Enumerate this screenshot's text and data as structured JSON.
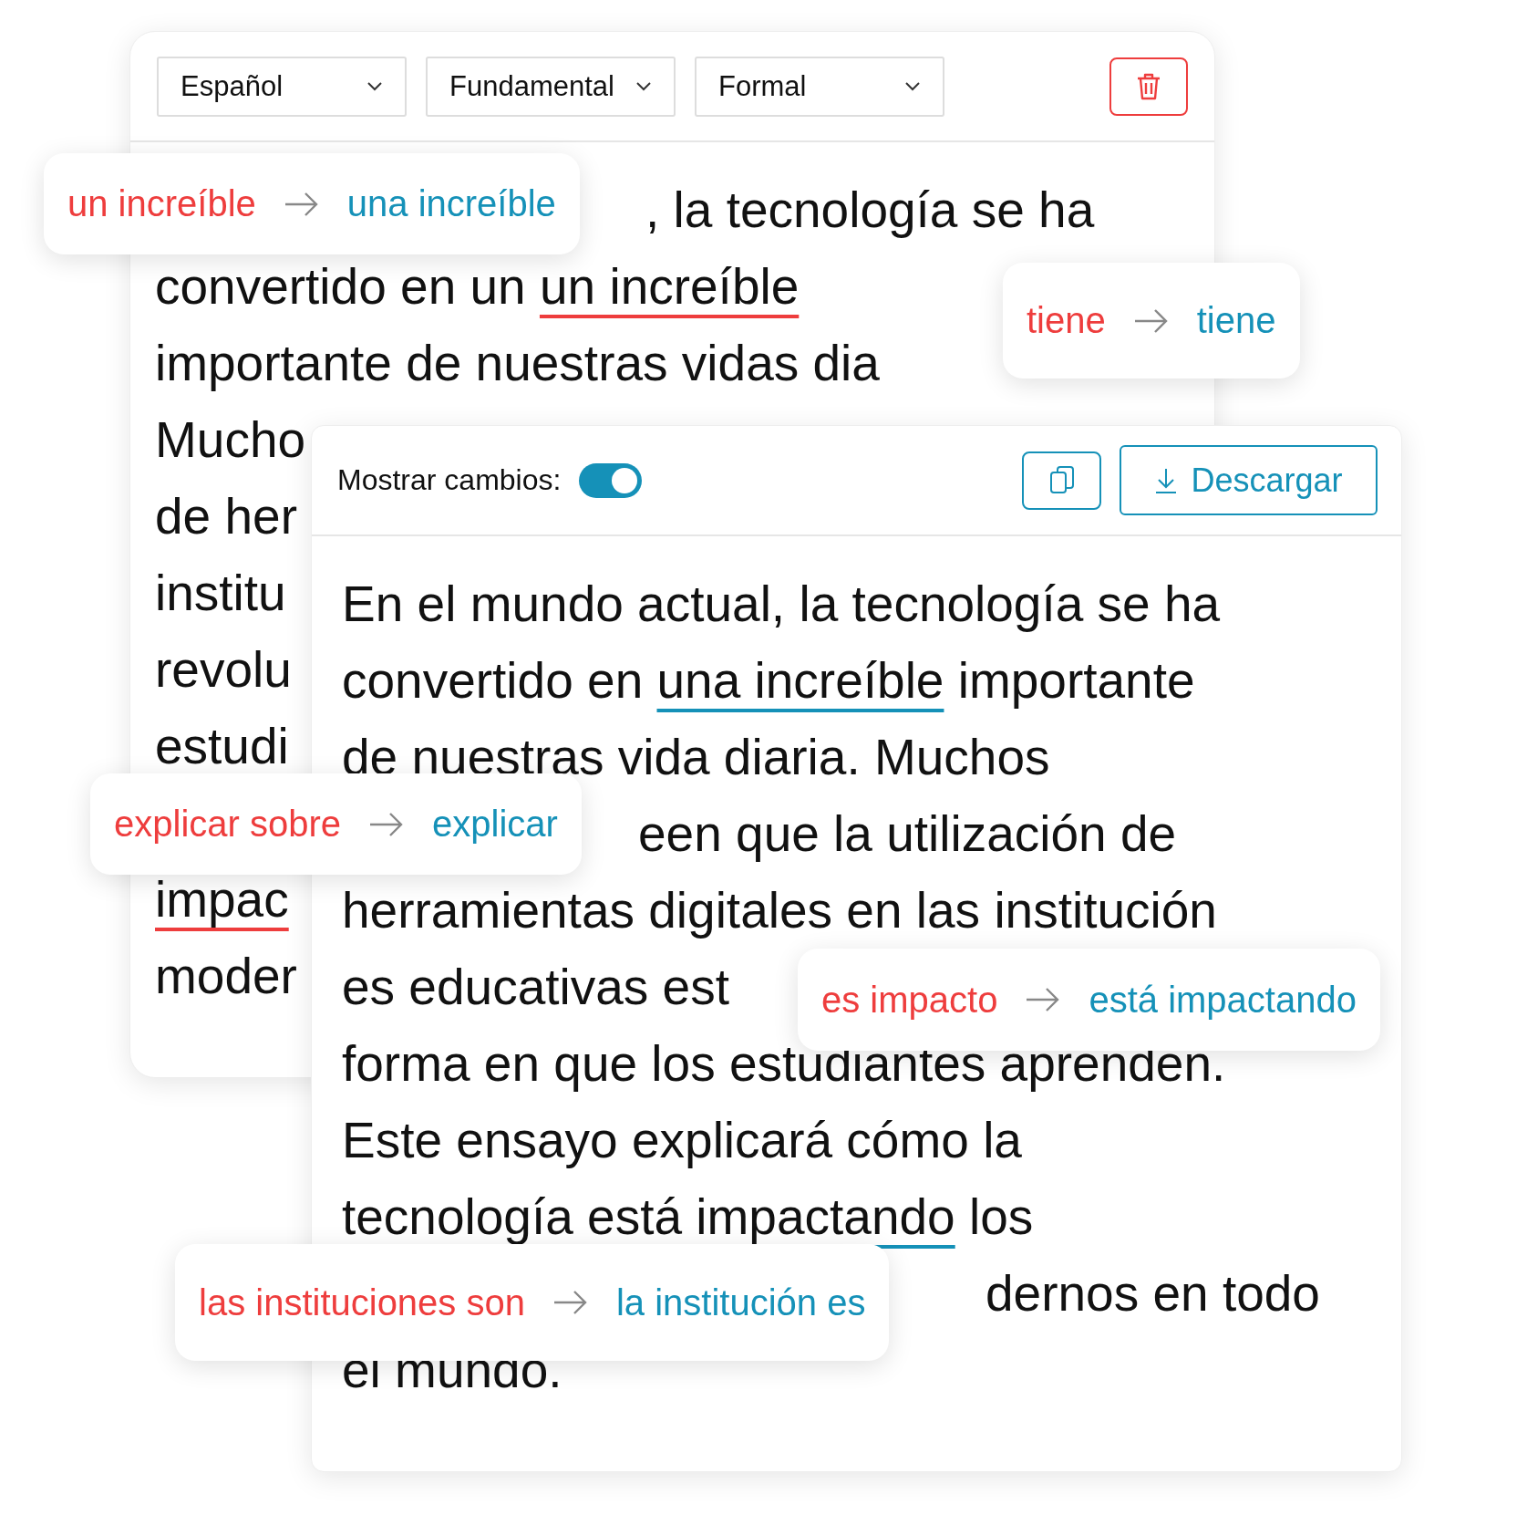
{
  "editor": {
    "dropdowns": [
      {
        "value": "Español"
      },
      {
        "value": "Fundamental"
      },
      {
        "value": "Formal"
      }
    ],
    "lines": [
      {
        "segments": [
          {
            "kind": "plain",
            "text": ", la tecnología se ha"
          }
        ]
      },
      {
        "segments": [
          {
            "kind": "plain",
            "text": "convertido en un "
          },
          {
            "kind": "error",
            "text": "un increíble"
          }
        ]
      },
      {
        "segments": [
          {
            "kind": "plain",
            "text": "importante de nuestras vidas dia"
          }
        ]
      },
      {
        "segments": [
          {
            "kind": "plain",
            "text": "Mucho"
          }
        ]
      },
      {
        "segments": [
          {
            "kind": "plain",
            "text": "de her"
          }
        ]
      },
      {
        "segments": [
          {
            "kind": "plain",
            "text": "institu"
          }
        ]
      },
      {
        "segments": [
          {
            "kind": "plain",
            "text": "revolu"
          }
        ]
      },
      {
        "segments": [
          {
            "kind": "plain",
            "text": "estudi"
          }
        ]
      },
      {
        "segments": [
          {
            "kind": "error",
            "text": "impac"
          }
        ]
      },
      {
        "segments": [
          {
            "kind": "plain",
            "text": "moder"
          }
        ]
      }
    ]
  },
  "result": {
    "show_changes": {
      "label": "Mostrar cambios:",
      "on": true
    },
    "download_label": "Descargar",
    "lines": [
      {
        "segments": [
          {
            "kind": "plain",
            "text": "En el mundo actual, la tecnología se ha"
          }
        ]
      },
      {
        "segments": [
          {
            "kind": "plain",
            "text": "convertido en "
          },
          {
            "kind": "fix",
            "text": "una increíble"
          },
          {
            "kind": "plain",
            "text": " importante"
          }
        ]
      },
      {
        "segments": [
          {
            "kind": "plain",
            "text": "de nuestras vida diaria. Muchos"
          }
        ]
      },
      {
        "segments": [
          {
            "kind": "plain",
            "text": "een que la utilización de"
          }
        ]
      },
      {
        "segments": [
          {
            "kind": "plain",
            "text": "herramientas digitales en las institución"
          }
        ]
      },
      {
        "segments": [
          {
            "kind": "plain",
            "text": "es educativas est"
          }
        ]
      },
      {
        "segments": [
          {
            "kind": "plain",
            "text": "forma en que los estudiantes aprenden."
          }
        ]
      },
      {
        "segments": [
          {
            "kind": "plain",
            "text": "Este ensayo explicará cómo la"
          }
        ]
      },
      {
        "segments": [
          {
            "kind": "plain",
            "text": "tecnología "
          },
          {
            "kind": "fix",
            "text": "está impactando"
          },
          {
            "kind": "plain",
            "text": " los"
          }
        ]
      },
      {
        "segments": [
          {
            "kind": "plain",
            "text": "dernos en todo"
          }
        ]
      },
      {
        "segments": [
          {
            "kind": "plain",
            "text": "el mundo."
          }
        ]
      }
    ]
  },
  "suggestions": [
    {
      "original": "un increíble",
      "suggested": "una increíble"
    },
    {
      "original": "tiene",
      "suggested": "tiene"
    },
    {
      "original": "explicar sobre",
      "suggested": "explicar"
    },
    {
      "original": "es impacto",
      "suggested": "está impactando"
    },
    {
      "original": "las instituciones son",
      "suggested": "la institución es"
    }
  ]
}
